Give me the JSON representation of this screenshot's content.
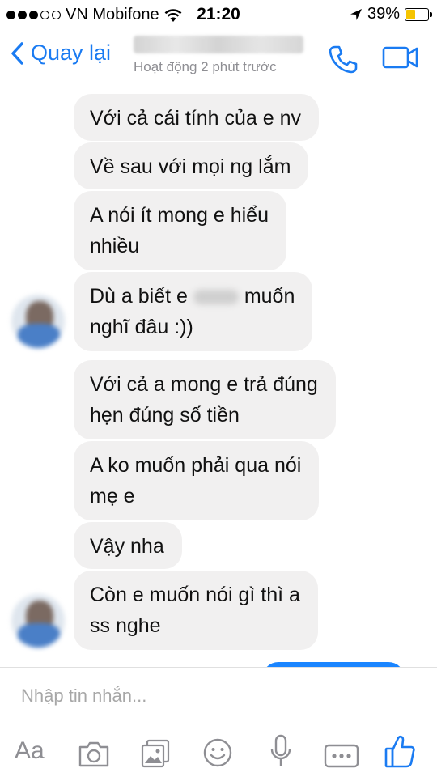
{
  "status_bar": {
    "carrier": "VN Mobifone",
    "time": "21:20",
    "battery": "39%",
    "battery_level": 0.39,
    "colors": {
      "battery_fill": "#f5c400"
    }
  },
  "header": {
    "back_label": "Quay lại",
    "subtitle": "Hoạt động 2 phút trước",
    "icons": [
      "back-chevron-icon",
      "phone-icon",
      "video-call-icon"
    ],
    "accent": "#1a7bf2"
  },
  "messages": [
    {
      "text": "Với cả cái tính của e nv"
    },
    {
      "text": "Về sau với mọi ng lắm"
    },
    {
      "line1": "A nói ít mong e hiểu",
      "line2": "nhiều"
    },
    {
      "line1_before": "Dù a biết e",
      "line1_after": "muốn",
      "line2": "nghĩ đâu :))"
    },
    {
      "line1": "Với cả a mong e trả đúng",
      "line2": "hẹn đúng số tiền"
    },
    {
      "line1": "A ko muốn phải qua nói",
      "line2": "mẹ e"
    },
    {
      "text": "Vậy nha"
    },
    {
      "line1": "Còn e muốn nói gì thì a",
      "line2": "ss nghe"
    }
  ],
  "composer": {
    "placeholder": "Nhập tin nhắn...",
    "aa_label": "Aa",
    "icons": [
      "text-format-icon",
      "camera-icon",
      "photo-gallery-icon",
      "emoji-icon",
      "microphone-icon",
      "more-icon",
      "like-icon"
    ]
  },
  "colors": {
    "bubble_received": "#f1f0f0",
    "bubble_sent": "#1a85ff",
    "icon_gray": "#8e8e93"
  }
}
